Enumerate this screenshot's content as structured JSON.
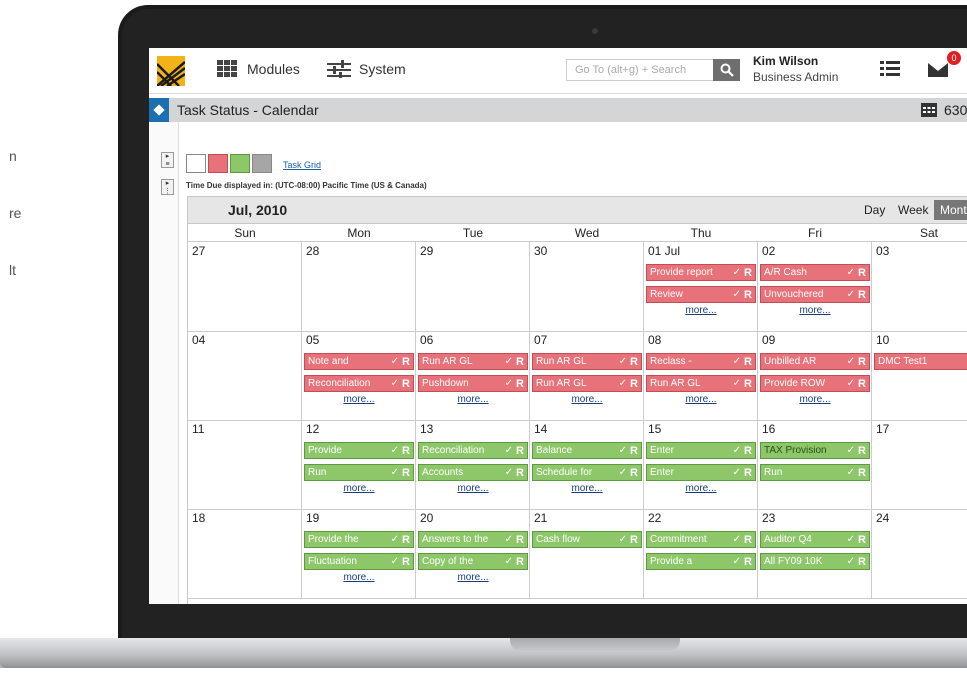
{
  "side_text": [
    "n",
    "re",
    "lt"
  ],
  "header": {
    "modules_label": "Modules",
    "system_label": "System",
    "search_placeholder": "Go To (alt+g) + Search",
    "user_name": "Kim Wilson",
    "user_role": "Business Admin",
    "notification_count": "0"
  },
  "titlebar": {
    "title": "Task Status - Calendar",
    "count": "630"
  },
  "legend": {
    "colors": [
      "#ffffff",
      "#e8727a",
      "#8dc76a",
      "#a6a6a6"
    ],
    "task_grid_link": "Task Grid",
    "timezone": "Time Due displayed in: (UTC-08:00) Pacific Time (US & Canada)"
  },
  "calendar": {
    "month": "Jul, 2010",
    "views": [
      "Day",
      "Week",
      "Month"
    ],
    "active_view": "Month",
    "days_of_week": [
      "Sun",
      "Mon",
      "Tue",
      "Wed",
      "Thu",
      "Fri",
      "Sat"
    ],
    "more_label": "more...",
    "check_mark": "✓",
    "r_mark": "R",
    "weeks": [
      [
        {
          "num": "27",
          "tasks": []
        },
        {
          "num": "28",
          "tasks": []
        },
        {
          "num": "29",
          "tasks": []
        },
        {
          "num": "30",
          "tasks": []
        },
        {
          "num": "01 Jul",
          "tasks": [
            {
              "label": "Provide report",
              "status": "red"
            },
            {
              "label": "Review",
              "status": "red"
            }
          ],
          "more": true
        },
        {
          "num": "02",
          "tasks": [
            {
              "label": "A/R Cash",
              "status": "red"
            },
            {
              "label": "Unvouchered",
              "status": "red"
            }
          ],
          "more": true
        },
        {
          "num": "03",
          "tasks": []
        }
      ],
      [
        {
          "num": "04",
          "tasks": []
        },
        {
          "num": "05",
          "tasks": [
            {
              "label": "Note and",
              "status": "red"
            },
            {
              "label": "Reconciliation",
              "status": "red"
            }
          ],
          "more": true
        },
        {
          "num": "06",
          "tasks": [
            {
              "label": "Run AR GL",
              "status": "red"
            },
            {
              "label": "Pushdown",
              "status": "red"
            }
          ],
          "more": true
        },
        {
          "num": "07",
          "tasks": [
            {
              "label": "Run AR GL",
              "status": "red"
            },
            {
              "label": "Run AR GL",
              "status": "red"
            }
          ],
          "more": true
        },
        {
          "num": "08",
          "tasks": [
            {
              "label": "Reclass -",
              "status": "red"
            },
            {
              "label": "Run AR GL",
              "status": "red"
            }
          ],
          "more": true
        },
        {
          "num": "09",
          "tasks": [
            {
              "label": "Unbilled AR",
              "status": "red"
            },
            {
              "label": "Provide ROW",
              "status": "red"
            }
          ],
          "more": true
        },
        {
          "num": "10",
          "tasks": [
            {
              "label": "DMC Test1",
              "status": "red",
              "nocheck": true
            }
          ]
        }
      ],
      [
        {
          "num": "11",
          "tasks": []
        },
        {
          "num": "12",
          "tasks": [
            {
              "label": "Provide",
              "status": "green"
            },
            {
              "label": "Run",
              "status": "green"
            }
          ],
          "more": true
        },
        {
          "num": "13",
          "tasks": [
            {
              "label": "Reconciliation",
              "status": "green"
            },
            {
              "label": "Accounts",
              "status": "green"
            }
          ],
          "more": true
        },
        {
          "num": "14",
          "tasks": [
            {
              "label": "Balance",
              "status": "green"
            },
            {
              "label": "Schedule for",
              "status": "green"
            }
          ],
          "more": true
        },
        {
          "num": "15",
          "tasks": [
            {
              "label": "Enter",
              "status": "green"
            },
            {
              "label": "Enter",
              "status": "green"
            }
          ],
          "more": true
        },
        {
          "num": "16",
          "tasks": [
            {
              "label": "TAX Provision",
              "status": "green",
              "dark": true
            },
            {
              "label": "Run",
              "status": "green"
            }
          ]
        },
        {
          "num": "17",
          "tasks": []
        }
      ],
      [
        {
          "num": "18",
          "tasks": []
        },
        {
          "num": "19",
          "tasks": [
            {
              "label": "Provide the",
              "status": "green"
            },
            {
              "label": "Fluctuation",
              "status": "green"
            }
          ],
          "more": true
        },
        {
          "num": "20",
          "tasks": [
            {
              "label": "Answers to the",
              "status": "green"
            },
            {
              "label": "Copy of the",
              "status": "green"
            }
          ],
          "more": true
        },
        {
          "num": "21",
          "tasks": [
            {
              "label": "Cash flow",
              "status": "green"
            }
          ]
        },
        {
          "num": "22",
          "tasks": [
            {
              "label": "Commitment",
              "status": "green"
            },
            {
              "label": "Provide a",
              "status": "green"
            }
          ]
        },
        {
          "num": "23",
          "tasks": [
            {
              "label": "Auditor Q4",
              "status": "green"
            },
            {
              "label": "All FY09 10K",
              "status": "green"
            }
          ]
        },
        {
          "num": "24",
          "tasks": []
        }
      ]
    ]
  }
}
